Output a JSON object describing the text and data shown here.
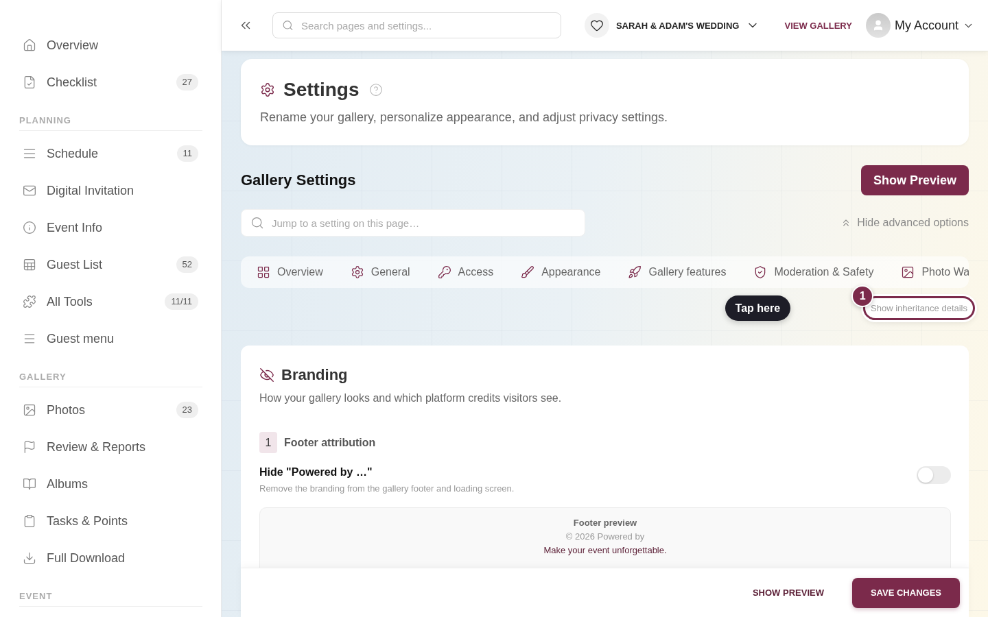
{
  "sidebar": {
    "sections": [
      {
        "items": [
          {
            "label": "Overview",
            "selected": false
          },
          {
            "label": "Checklist",
            "count": "27",
            "selected": false
          }
        ]
      },
      {
        "title": "PLANNING",
        "items": [
          {
            "label": "Schedule",
            "count": "11",
            "selected": false
          },
          {
            "label": "Digital Invitation",
            "selected": false
          },
          {
            "label": "Event Info",
            "selected": false
          },
          {
            "label": "Guest List",
            "count": "52",
            "selected": false
          },
          {
            "label": "All Tools",
            "count": "11/11",
            "selected": false
          },
          {
            "label": "Guest menu",
            "selected": false
          }
        ]
      },
      {
        "title": "GALLERY",
        "items": [
          {
            "label": "Photos",
            "count": "23",
            "selected": false
          },
          {
            "label": "Review & Reports",
            "selected": false
          },
          {
            "label": "Albums",
            "selected": false
          },
          {
            "label": "Tasks & Points",
            "selected": false
          },
          {
            "label": "Full Download",
            "selected": false
          }
        ]
      },
      {
        "title": "EVENT"
      }
    ]
  },
  "top_bar": {
    "search": {
      "placeholder": "Search pages and settings..."
    },
    "event": "SARAH & ADAM'S WEDDING",
    "view_gallery": "VIEW GALLERY",
    "account": "My Account"
  },
  "page": {
    "title": "Settings",
    "description": "Rename your gallery, personalize appearance, and adjust privacy settings."
  },
  "gallery_settings": {
    "title": "Gallery Settings",
    "preview_button": "Show Preview",
    "jump_search": {
      "placeholder": "Jump to a setting on this page…"
    },
    "advanced_toggle": "Hide advanced options",
    "tabs": [
      {
        "label": "Overview",
        "selected": false
      },
      {
        "label": "General",
        "selected": false
      },
      {
        "label": "Access",
        "selected": false
      },
      {
        "label": "Appearance",
        "selected": false
      },
      {
        "label": "Gallery features",
        "selected": false
      },
      {
        "label": "Moderation & Safety",
        "selected": false
      },
      {
        "label": "Photo Wa",
        "selected": false
      }
    ],
    "tooltip": "Tap here",
    "coach_step": "1",
    "inheritance_button": "Show inheritance details"
  },
  "branding": {
    "title": "Branding",
    "description": "How your gallery looks and which platform credits visitors see.",
    "groups": [
      {
        "number": "1",
        "title": "Footer attribution",
        "settings": [
          {
            "label": "Hide \"Powered by …\"",
            "description": "Remove the branding from the gallery footer and loading screen.",
            "on": false,
            "preview": {
              "title": "Footer preview",
              "copyright": "© 2026 Powered by",
              "tagline": "Make your event unforgettable."
            }
          }
        ]
      }
    ]
  },
  "action_bar": {
    "secondary": "SHOW PREVIEW",
    "primary": "SAVE CHANGES"
  }
}
